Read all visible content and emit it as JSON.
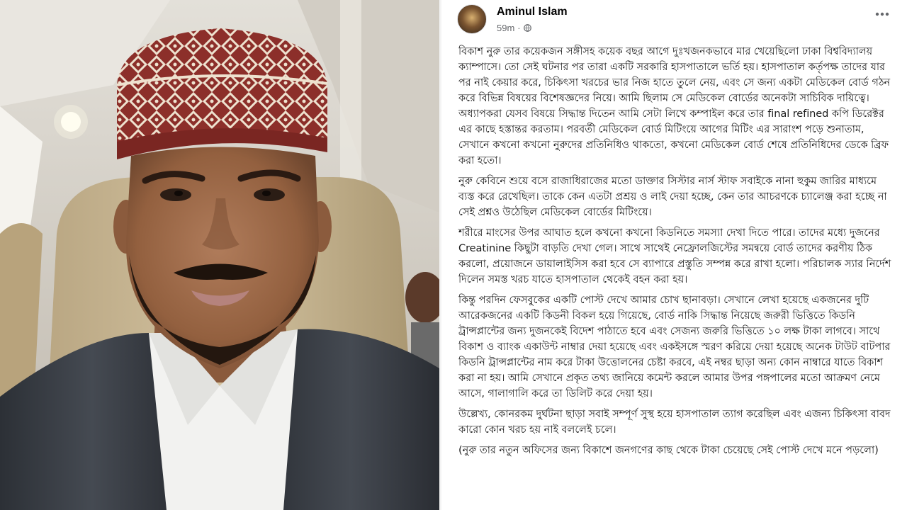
{
  "post": {
    "author": "Aminul Islam",
    "time": "59m",
    "time_separator": "·",
    "privacy_icon": "globe-icon",
    "more_icon": "more-options-icon",
    "paragraphs": [
      "বিকাশ নুরু তার কয়েকজন সঙ্গীসহ কয়েক বছর আগে দুঃখজনকভাবে মার খেয়েছিলো ঢাকা বিশ্ববিদ্যালয় ক্যাম্পাসে। তো সেই ঘটনার পর তারা একটি সরকারি হাসপাতালে ভর্তি হয়। হাসপাতাল কর্তৃপক্ষ তাদের যার পর নাই কেয়ার করে, চিকিৎসা খরচের ভার নিজ হাতে তুলে নেয়, এবং সে জন্য একটা মেডিকেল বোর্ড গঠন করে বিভিন্ন বিষয়ের বিশেষজ্ঞদের নিয়ে। আমি ছিলাম সে মেডিকেল বোর্ডের অনেকটা সাচিবিক দায়িত্বে। অধ্যাপকরা যেসব বিষয়ে সিদ্ধান্ত দিতেন আমি সেটা লিখে কম্পাইল করে তার final refined কপি ডিরেক্টর এর কাছে হস্তান্তর করতাম। পরবর্তী মেডিকেল বোর্ড মিটিংয়ে আগের মিটিং এর সারাংশ পড়ে শুনাতাম, সেখানে কখনো কখনো নুরুদের প্রতিনিধিও থাকতো, কখনো মেডিকেল বোর্ড শেষে প্রতিনিধিদের ডেকে ব্রিফ করা হতো।",
      "নুরু কেবিনে শুয়ে বসে রাজাধিরাজের মতো ডাক্তার সিস্টার নার্স স্টাফ সবাইকে নানা হুকুম জারির মাধ্যমে ব্যস্ত করে রেখেছিল। তাকে কেন এতটা প্রশ্রয় ও লাই দেয়া হচ্ছে, কেন তার আচরণকে চ্যালেঞ্জ করা হচ্ছে না সেই প্রশ্নও উঠেছিল মেডিকেল বোর্ডের মিটিংয়ে।",
      "শরীরে মাংসের উপর আঘাত হলে কখনো কখনো কিডনিতে সমস্যা দেখা দিতে পারে। তাদের মধ্যে দুজনের Creatinine কিছুটা বাড়তি দেখা গেল। সাথে সাথেই নেফ্রোলজিস্টের সমন্বয়ে বোর্ড তাদের করণীয় ঠিক করলো, প্রয়োজনে ডায়ালাইসিস করা হবে সে ব্যাপারে প্রস্তুতি সম্পন্ন করে রাখা হলো। পরিচালক স্যার নির্দেশ দিলেন সমস্ত খরচ যাতে হাসপাতাল থেকেই বহন করা হয়।",
      "কিন্তু পরদিন ফেসবুকের একটি পোস্ট দেখে আমার চোখ ছানাবড়া। সেখানে লেখা হয়েছে একজনের দুটি আরেকজনের একটি কিডনী বিকল হয়ে গিয়েছে, বোর্ড নাকি সিদ্ধান্ত নিয়েছে জরুরী ভিত্তিতে কিডনি ট্রান্সপ্লান্টের জন্য দুজনকেই বিদেশ পাঠাতে হবে এবং সেজন্য জরুরি ভিত্তিতে ১০ লক্ষ টাকা লাগবে। সাথে বিকাশ ও ব্যাংক একাউন্ট নাম্বার দেয়া হয়েছে এবং একইসঙ্গে স্মরণ করিয়ে দেয়া হয়েছে অনেক টাউট বাটপার কিডনি ট্রান্সপ্লান্টের নাম করে টাকা উত্তোলনের চেষ্টা করবে, এই নম্বর ছাড়া অন্য কোন নাম্বারে যাতে বিকাশ করা না হয়। আমি সেখানে প্রকৃত তথ্য জানিয়ে কমেন্ট করলে আমার উপর পঙ্গপালের মতো আক্রমণ নেমে আসে, গালাগালি করে তা ডিলিট করে দেয়া হয়।",
      "উল্লেখ্য, কোনরকম দুর্ঘটনা ছাড়া সবাই সম্পূর্ণ সুস্থ হয়ে হাসপাতাল ত্যাগ করেছিল এবং এজন্য চিকিৎসা বাবদ কারো কোন খরচ হয় নাই বললেই চলে।",
      "(নুরু তার নতুন অফিসের জন্য বিকাশে জনগণের কাছ থেকে টাকা চেয়েছে সেই পোস্ট দেখে মনে পড়লো)"
    ]
  },
  "photo": {
    "colors": {
      "skin": "#9b6a4c",
      "cap_red": "#8c2f2a",
      "cap_cream": "#eee2cf",
      "jacket": "#3a3f46",
      "shirt": "#f2f2f0",
      "seat": "#c9b896",
      "cabin": "#d8d4cc"
    }
  }
}
